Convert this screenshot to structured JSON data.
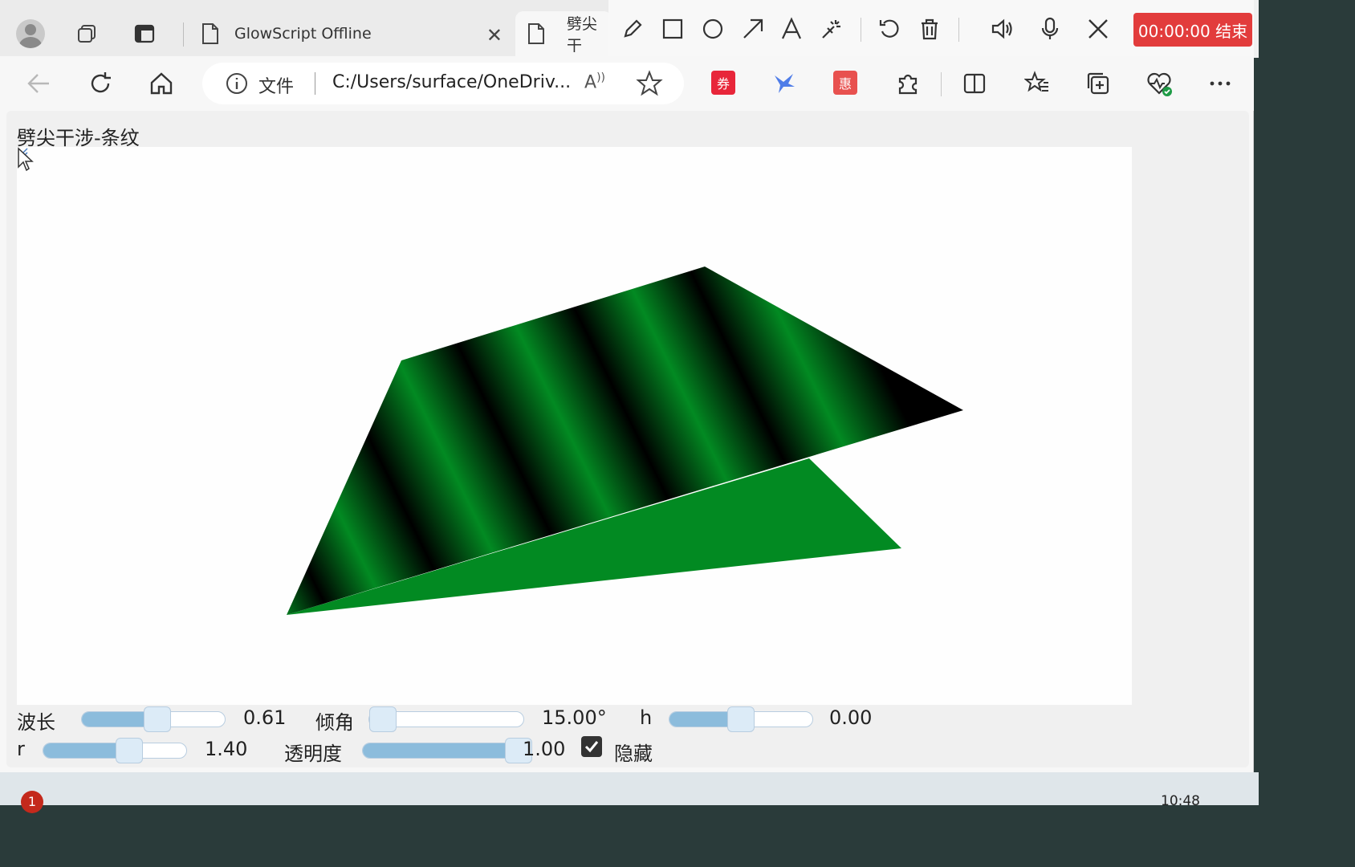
{
  "browser": {
    "tabs": [
      {
        "title": "GlowScript Offline"
      },
      {
        "title": "劈尖干"
      }
    ],
    "address": {
      "site_label": "文件",
      "url": "C:/Users/surface/OneDriv..."
    }
  },
  "recorder": {
    "button_label": "00:00:00 结束"
  },
  "extensions": [
    {
      "name": "coupon-extension",
      "label": "券",
      "color": "#e8263a"
    },
    {
      "name": "bird-extension",
      "label": "",
      "color": "#4f7de8"
    },
    {
      "name": "deal-extension",
      "label": "惠",
      "color": "#e8514f"
    }
  ],
  "page": {
    "title": "劈尖干涉-条纹"
  },
  "controls": {
    "wavelength": {
      "label": "波长",
      "value": "0.61",
      "fraction": 0.53
    },
    "tilt": {
      "label": "倾角",
      "value": "15.00°",
      "fraction": 0.09
    },
    "h": {
      "label": "h",
      "value": "0.00",
      "fraction": 0.5
    },
    "r": {
      "label": "r",
      "value": "1.40",
      "fraction": 0.6
    },
    "opacity": {
      "label": "透明度",
      "value": "1.00",
      "fraction": 1.0
    },
    "hide": {
      "label": "隐藏",
      "checked": true
    }
  },
  "colors": {
    "fringe_green": "#028a22",
    "fringe_dark": "#000000",
    "slider_fill": "#8cbcdc",
    "record_red": "#e23c3c"
  },
  "taskbar": {
    "notification_count": "1",
    "clock": "10:48"
  }
}
